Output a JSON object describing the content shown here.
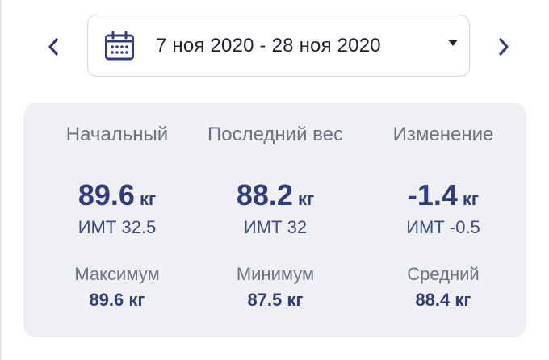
{
  "date_range": {
    "label": "7 ноя 2020 - 28 ноя 2020"
  },
  "colors": {
    "accent": "#2f3c7e",
    "muted_text": "#6b7282",
    "card_background": "#eef0f4",
    "border": "#d3d6de"
  },
  "icons": {
    "prev": "chevron-left-icon",
    "next": "chevron-right-icon",
    "calendar": "calendar-icon",
    "dropdown": "caret-down-icon"
  },
  "stats": {
    "start": {
      "heading": "Начальный",
      "value": "89.6",
      "unit": "кг",
      "bmi": "ИМТ 32.5"
    },
    "last": {
      "heading": "Последний вес",
      "value": "88.2",
      "unit": "кг",
      "bmi": "ИМТ 32"
    },
    "change": {
      "heading": "Изменение",
      "value": "-1.4",
      "unit": "кг",
      "bmi": "ИМТ -0.5"
    },
    "max": {
      "heading": "Максимум",
      "value": "89.6 кг"
    },
    "min": {
      "heading": "Минимум",
      "value": "87.5 кг"
    },
    "avg": {
      "heading": "Средний",
      "value": "88.4 кг"
    }
  }
}
